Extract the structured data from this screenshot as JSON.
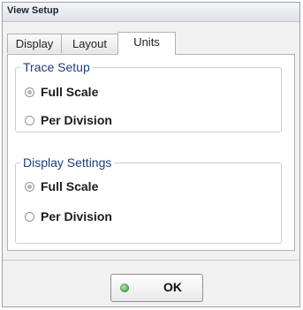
{
  "window": {
    "title": "View Setup"
  },
  "tabs": [
    {
      "label": "Display"
    },
    {
      "label": "Layout"
    },
    {
      "label": "Units",
      "active": true
    }
  ],
  "trace_setup": {
    "legend": "Trace Setup",
    "options": [
      {
        "label": "Full Scale",
        "selected": true
      },
      {
        "label": "Per Division",
        "selected": false
      }
    ]
  },
  "display_settings": {
    "legend": "Display Settings",
    "options": [
      {
        "label": "Full Scale",
        "selected": true
      },
      {
        "label": "Per Division",
        "selected": false
      }
    ]
  },
  "ok_button": {
    "label": "OK",
    "indicator": "green-led-icon",
    "indicator_color": "#3a9a3a"
  },
  "colors": {
    "legend_text": "#1e3f7a"
  }
}
